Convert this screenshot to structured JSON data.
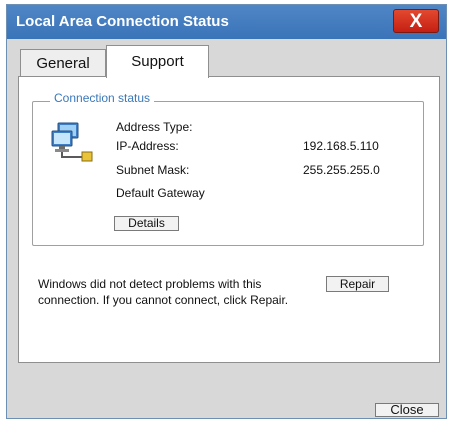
{
  "window": {
    "title": "Local Area Connection Status",
    "close_glyph": "X"
  },
  "tabs": [
    {
      "label": "General"
    },
    {
      "label": "Support"
    }
  ],
  "connection_status": {
    "legend": "Connection status",
    "rows": [
      {
        "label": "Address Type:",
        "value": ""
      },
      {
        "label": "IP-Address:",
        "value": "192.168.5.110"
      },
      {
        "label": "Subnet Mask:",
        "value": "255.255.255.0"
      },
      {
        "label": "Default Gateway",
        "value": ""
      }
    ],
    "details_button": "Details",
    "icon": "network-connection-icon"
  },
  "diagnostics": {
    "message": "Windows did not detect problems with this connection. If you cannot connect, click Repair.",
    "repair_button": "Repair"
  },
  "footer": {
    "close_button": "Close"
  },
  "colors": {
    "titlebar": "#3f79bf",
    "close_button": "#d8341f",
    "legend_text": "#3b78b9",
    "background": "#d8d8d8"
  }
}
